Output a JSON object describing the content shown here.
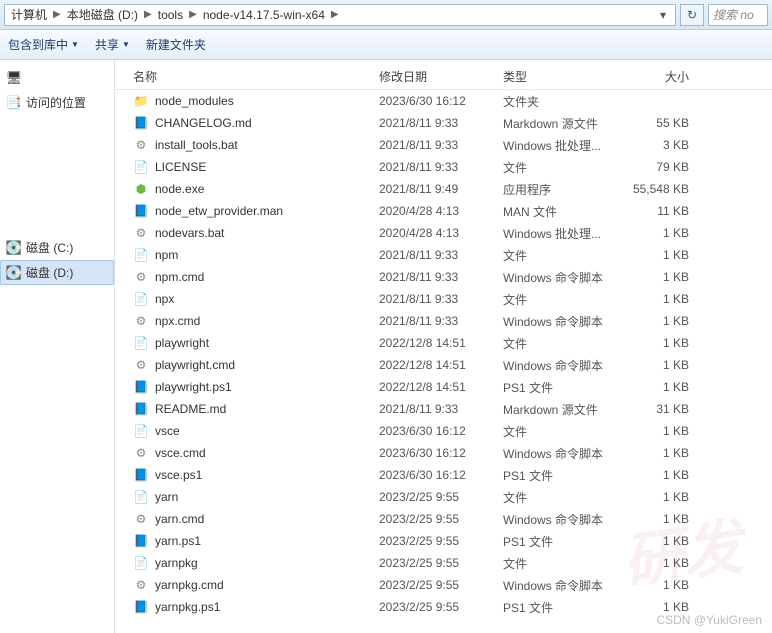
{
  "breadcrumbs": [
    "计算机",
    "本地磁盘 (D:)",
    "tools",
    "node-v14.17.5-win-x64"
  ],
  "search_placeholder": "搜索 no",
  "toolbar": {
    "include": "包含到库中",
    "share": "共享",
    "newfolder": "新建文件夹"
  },
  "sidebar": {
    "recent": "访问的位置",
    "c_drive": "磁盘 (C:)",
    "d_drive": "磁盘 (D:)"
  },
  "columns": {
    "name": "名称",
    "date": "修改日期",
    "type": "类型",
    "size": "大小"
  },
  "files": [
    {
      "icon": "folder",
      "name": "node_modules",
      "date": "2023/6/30 16:12",
      "type": "文件夹",
      "size": ""
    },
    {
      "icon": "md",
      "name": "CHANGELOG.md",
      "date": "2021/8/11 9:33",
      "type": "Markdown 源文件",
      "size": "55 KB"
    },
    {
      "icon": "bat",
      "name": "install_tools.bat",
      "date": "2021/8/11 9:33",
      "type": "Windows 批处理...",
      "size": "3 KB"
    },
    {
      "icon": "file",
      "name": "LICENSE",
      "date": "2021/8/11 9:33",
      "type": "文件",
      "size": "79 KB"
    },
    {
      "icon": "exe",
      "name": "node.exe",
      "date": "2021/8/11 9:49",
      "type": "应用程序",
      "size": "55,548 KB"
    },
    {
      "icon": "man",
      "name": "node_etw_provider.man",
      "date": "2020/4/28 4:13",
      "type": "MAN 文件",
      "size": "11 KB"
    },
    {
      "icon": "bat",
      "name": "nodevars.bat",
      "date": "2020/4/28 4:13",
      "type": "Windows 批处理...",
      "size": "1 KB"
    },
    {
      "icon": "file",
      "name": "npm",
      "date": "2021/8/11 9:33",
      "type": "文件",
      "size": "1 KB"
    },
    {
      "icon": "cmd",
      "name": "npm.cmd",
      "date": "2021/8/11 9:33",
      "type": "Windows 命令脚本",
      "size": "1 KB"
    },
    {
      "icon": "file",
      "name": "npx",
      "date": "2021/8/11 9:33",
      "type": "文件",
      "size": "1 KB"
    },
    {
      "icon": "cmd",
      "name": "npx.cmd",
      "date": "2021/8/11 9:33",
      "type": "Windows 命令脚本",
      "size": "1 KB"
    },
    {
      "icon": "file",
      "name": "playwright",
      "date": "2022/12/8 14:51",
      "type": "文件",
      "size": "1 KB"
    },
    {
      "icon": "cmd",
      "name": "playwright.cmd",
      "date": "2022/12/8 14:51",
      "type": "Windows 命令脚本",
      "size": "1 KB"
    },
    {
      "icon": "ps1",
      "name": "playwright.ps1",
      "date": "2022/12/8 14:51",
      "type": "PS1 文件",
      "size": "1 KB"
    },
    {
      "icon": "md",
      "name": "README.md",
      "date": "2021/8/11 9:33",
      "type": "Markdown 源文件",
      "size": "31 KB"
    },
    {
      "icon": "file",
      "name": "vsce",
      "date": "2023/6/30 16:12",
      "type": "文件",
      "size": "1 KB"
    },
    {
      "icon": "cmd",
      "name": "vsce.cmd",
      "date": "2023/6/30 16:12",
      "type": "Windows 命令脚本",
      "size": "1 KB"
    },
    {
      "icon": "ps1",
      "name": "vsce.ps1",
      "date": "2023/6/30 16:12",
      "type": "PS1 文件",
      "size": "1 KB"
    },
    {
      "icon": "file",
      "name": "yarn",
      "date": "2023/2/25 9:55",
      "type": "文件",
      "size": "1 KB"
    },
    {
      "icon": "cmd",
      "name": "yarn.cmd",
      "date": "2023/2/25 9:55",
      "type": "Windows 命令脚本",
      "size": "1 KB"
    },
    {
      "icon": "ps1",
      "name": "yarn.ps1",
      "date": "2023/2/25 9:55",
      "type": "PS1 文件",
      "size": "1 KB"
    },
    {
      "icon": "file",
      "name": "yarnpkg",
      "date": "2023/2/25 9:55",
      "type": "文件",
      "size": "1 KB"
    },
    {
      "icon": "cmd",
      "name": "yarnpkg.cmd",
      "date": "2023/2/25 9:55",
      "type": "Windows 命令脚本",
      "size": "1 KB"
    },
    {
      "icon": "ps1",
      "name": "yarnpkg.ps1",
      "date": "2023/2/25 9:55",
      "type": "PS1 文件",
      "size": "1 KB"
    }
  ],
  "watermark": "CSDN @YukiGreen"
}
